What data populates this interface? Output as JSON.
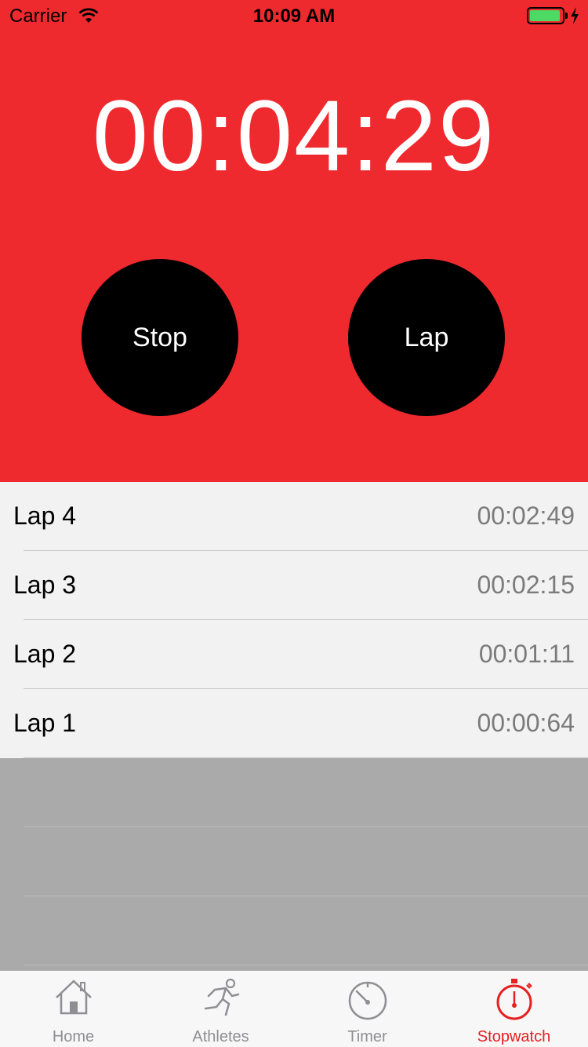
{
  "status_bar": {
    "carrier": "Carrier",
    "time": "10:09 AM",
    "battery_level": 0.95,
    "battery_color": "#4cd964"
  },
  "stopwatch": {
    "display": "00:04:29",
    "background_color": "#ef2a2e",
    "stop_label": "Stop",
    "lap_label": "Lap"
  },
  "laps": [
    {
      "name": "Lap 4",
      "time": "00:02:49"
    },
    {
      "name": "Lap 3",
      "time": "00:02:15"
    },
    {
      "name": "Lap 2",
      "time": "00:01:11"
    },
    {
      "name": "Lap 1",
      "time": "00:00:64"
    }
  ],
  "tabbar": {
    "tabs": [
      {
        "label": "Home",
        "icon": "home-icon",
        "active": false
      },
      {
        "label": "Athletes",
        "icon": "runner-icon",
        "active": false
      },
      {
        "label": "Timer",
        "icon": "timer-icon",
        "active": false
      },
      {
        "label": "Stopwatch",
        "icon": "stopwatch-icon",
        "active": true
      }
    ],
    "active_color": "#e62020",
    "inactive_color": "#8e8e93"
  }
}
